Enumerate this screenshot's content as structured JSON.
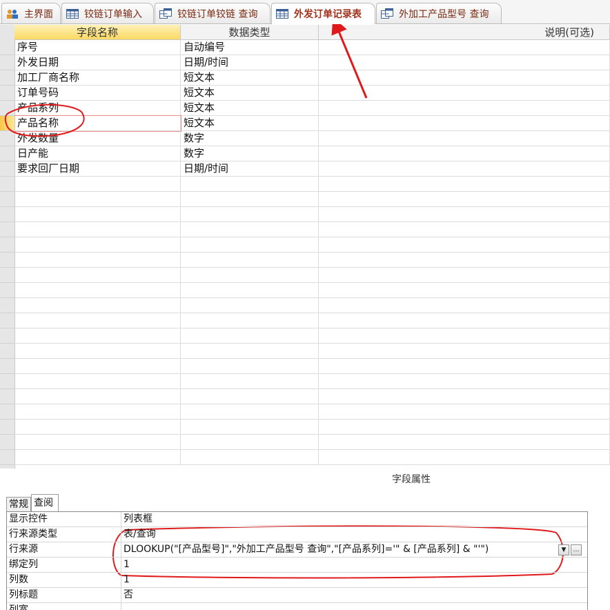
{
  "tabs": [
    {
      "label": "主界面",
      "icon": "form-icon"
    },
    {
      "label": "铰链订单输入",
      "icon": "table-icon"
    },
    {
      "label": "铰链订单铰链 查询",
      "icon": "query-icon"
    },
    {
      "label": "外发订单记录表",
      "icon": "table-icon",
      "active": true
    },
    {
      "label": "外加工产品型号 查询",
      "icon": "query-icon"
    }
  ],
  "grid": {
    "headers": {
      "field_name": "字段名称",
      "data_type": "数据类型",
      "description": "说明(可选)"
    },
    "rows": [
      {
        "field": "序号",
        "type": "自动编号"
      },
      {
        "field": "外发日期",
        "type": "日期/时间"
      },
      {
        "field": "加工厂商名称",
        "type": "短文本"
      },
      {
        "field": "订单号码",
        "type": "短文本"
      },
      {
        "field": "产品系列",
        "type": "短文本"
      },
      {
        "field": "产品名称",
        "type": "短文本"
      },
      {
        "field": "外发数量",
        "type": "数字"
      },
      {
        "field": "日产能",
        "type": "数字"
      },
      {
        "field": "要求回厂日期",
        "type": "日期/时间"
      }
    ]
  },
  "properties": {
    "title": "字段属性",
    "tabs": [
      "常规",
      "查阅"
    ],
    "rows": [
      {
        "name": "显示控件",
        "value": "列表框"
      },
      {
        "name": "行来源类型",
        "value": "表/查询"
      },
      {
        "name": "行来源",
        "value": "DLOOKUP(\"[产品型号]\",\"外加工产品型号 查询\",\"[产品系列]='\" & [产品系列] & \"'\")"
      },
      {
        "name": "绑定列",
        "value": "1"
      },
      {
        "name": "列数",
        "value": "1"
      },
      {
        "name": "列标题",
        "value": "否"
      },
      {
        "name": "列宽",
        "value": ""
      }
    ]
  },
  "colors": {
    "annotation_red": "#e0191b",
    "header_highlight": "#fde37a",
    "tab_text": "#7a2a12"
  }
}
